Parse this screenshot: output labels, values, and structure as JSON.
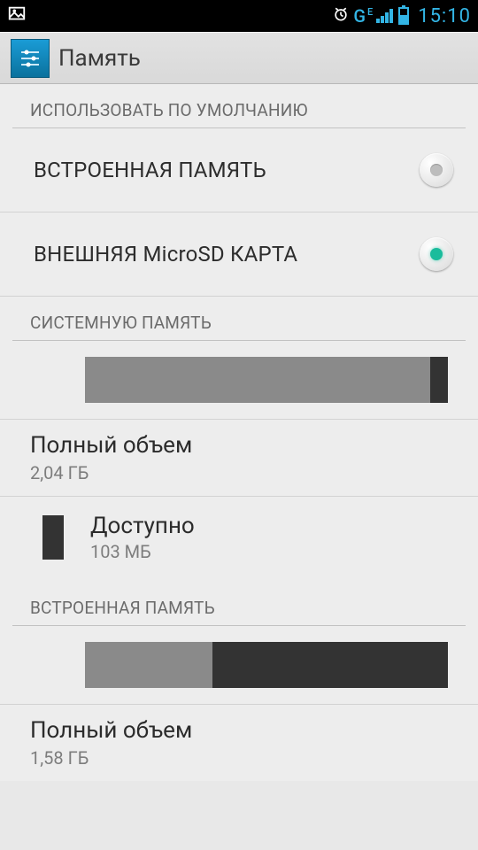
{
  "status": {
    "time": "15:10",
    "network_type": "G",
    "network_sub": "E"
  },
  "header": {
    "title": "Память"
  },
  "default_section": {
    "header": "ИСПОЛЬЗОВАТЬ ПО УМОЛЧАНИЮ",
    "options": [
      {
        "label": "ВСТРОЕННАЯ ПАМЯТЬ",
        "selected": false
      },
      {
        "label": "ВНЕШНЯЯ MicroSD КАРТА",
        "selected": true
      }
    ]
  },
  "system_memory": {
    "header": "СИСТЕМНУЮ ПАМЯТЬ",
    "bar": {
      "used_pct": 95,
      "free_pct": 5
    },
    "total_label": "Полный объем",
    "total_value": "2,04 ГБ",
    "available_label": "Доступно",
    "available_value": "103 МБ"
  },
  "internal_memory": {
    "header": "ВСТРОЕННАЯ ПАМЯТЬ",
    "bar": {
      "used_pct": 35,
      "free_pct": 65
    },
    "total_label": "Полный объем",
    "total_value": "1,58 ГБ"
  }
}
